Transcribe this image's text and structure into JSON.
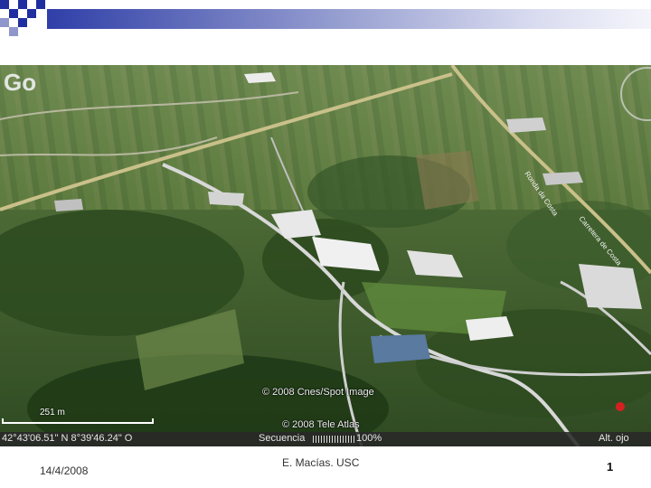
{
  "map": {
    "credit_spot": "© 2008 Cnes/Spot Image",
    "credit_tele": "© 2008 Tele Atlas",
    "scale_label": "251 m",
    "road_label_1": "Ronda da Costa",
    "road_label_2": "Carretera de Costa"
  },
  "status": {
    "coords": "42°43'06.51\" N    8°39'46.24\" O",
    "streaming_label": "Secuencia",
    "streaming_percent": "100%",
    "streaming_progress": 1.0,
    "eye_alt": "Alt. ojo"
  },
  "footer": {
    "date": "14/4/2008",
    "author": "E. Macías. USC",
    "page_number": "1"
  },
  "colors": {
    "accent_bar_start": "#2f3fa8",
    "accent_bar_end": "#f4f5fb"
  }
}
